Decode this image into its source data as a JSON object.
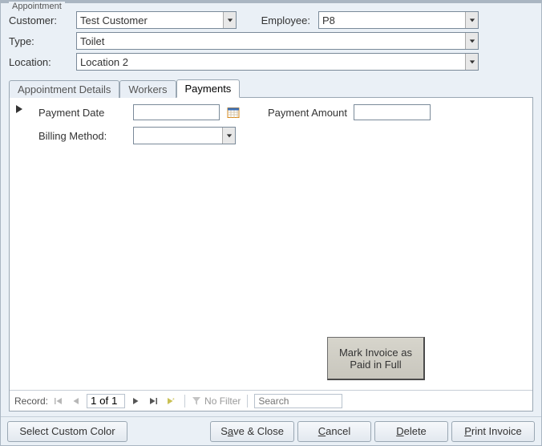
{
  "window": {
    "title": "Appointment"
  },
  "header": {
    "customer_label": "Customer:",
    "employee_label": "Employee:",
    "type_label": "Type:",
    "location_label": "Location:",
    "customer": "Test Customer",
    "employee": "P8",
    "type": "Toilet",
    "location": "Location 2"
  },
  "tabs": {
    "t0": "Appointment Details",
    "t1": "Workers",
    "t2": "Payments",
    "active": "t2"
  },
  "payments": {
    "payment_date_label": "Payment Date",
    "payment_amount_label": "Payment Amount",
    "billing_method_label": "Billing Method:",
    "payment_date": "",
    "payment_amount": "",
    "billing_method": "",
    "mark_paid_button": "Mark Invoice as Paid in Full"
  },
  "recordnav": {
    "label": "Record:",
    "position": "1 of 1",
    "nofilter": "No Filter",
    "search_placeholder": "Search"
  },
  "footer": {
    "select_color": "Select Custom Color",
    "save_close_pre": "S",
    "save_close_ul": "a",
    "save_close_post": "ve & Close",
    "cancel_ul": "C",
    "cancel_post": "ancel",
    "delete_ul": "D",
    "delete_post": "elete",
    "print_ul": "P",
    "print_post": "rint Invoice"
  }
}
